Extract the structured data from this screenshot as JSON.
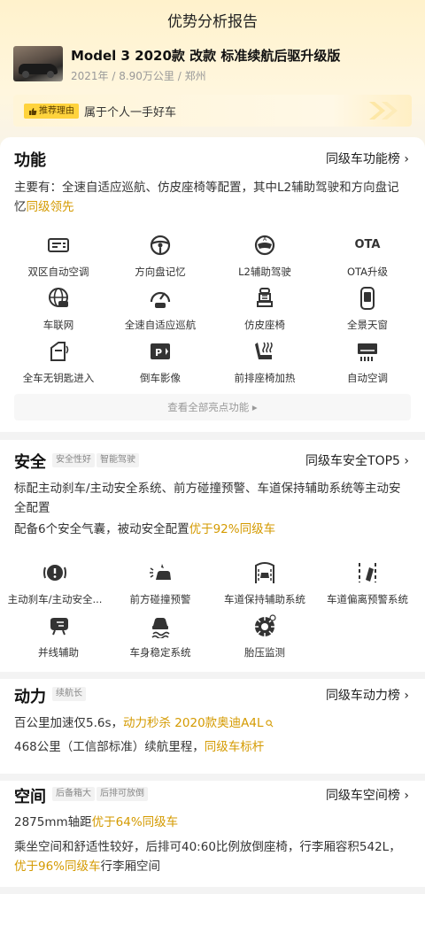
{
  "header": {
    "title": "优势分析报告"
  },
  "car": {
    "name": "Model 3 2020款 改款 标准续航后驱升级版",
    "meta": "2021年 / 8.90万公里 / 郑州",
    "thumb_icon": "car-photo"
  },
  "reason": {
    "tag": "推荐理由",
    "text": "属于个人一手好车"
  },
  "function": {
    "title": "功能",
    "link": "同级车功能榜 ›",
    "desc": "主要有：全速自适应巡航、仿皮座椅等配置，其中L2辅助驾驶和方向盘记忆",
    "desc_highlight": "同级领先",
    "items": [
      {
        "label": "双区自动空调",
        "icon": "dual-zone-ac-icon"
      },
      {
        "label": "方向盘记忆",
        "icon": "steering-wheel-icon"
      },
      {
        "label": "L2辅助驾驶",
        "icon": "assisted-driving-icon"
      },
      {
        "label": "OTA升级",
        "icon": "ota-icon",
        "glyph": "OTA"
      },
      {
        "label": "车联网",
        "icon": "connected-car-icon"
      },
      {
        "label": "全速自适应巡航",
        "icon": "adaptive-cruise-icon"
      },
      {
        "label": "仿皮座椅",
        "icon": "leather-seat-icon"
      },
      {
        "label": "全景天窗",
        "icon": "panoramic-roof-icon"
      },
      {
        "label": "全车无钥匙进入",
        "icon": "keyless-entry-icon"
      },
      {
        "label": "倒车影像",
        "icon": "reverse-camera-icon"
      },
      {
        "label": "前排座椅加热",
        "icon": "seat-heating-icon"
      },
      {
        "label": "自动空调",
        "icon": "auto-ac-icon"
      }
    ],
    "view_all": "查看全部亮点功能 ▸"
  },
  "safety": {
    "title": "安全",
    "chips": [
      "安全性好",
      "智能驾驶"
    ],
    "link": "同级车安全TOP5 ›",
    "desc1": "标配主动刹车/主动安全系统、前方碰撞预警、车道保持辅助系统等主动安全配置",
    "desc2_prefix": "配备6个安全气囊，被动安全配置",
    "desc2_highlight": "优于92%同级车",
    "items": [
      {
        "label": "主动刹车/主动安全...",
        "icon": "active-brake-icon"
      },
      {
        "label": "前方碰撞预警",
        "icon": "collision-warning-icon"
      },
      {
        "label": "车道保持辅助系统",
        "icon": "lane-keep-icon"
      },
      {
        "label": "车道偏离预警系统",
        "icon": "lane-departure-icon"
      },
      {
        "label": "并线辅助",
        "icon": "blind-spot-icon"
      },
      {
        "label": "车身稳定系统",
        "icon": "stability-control-icon"
      },
      {
        "label": "胎压监测",
        "icon": "tire-pressure-icon"
      }
    ]
  },
  "power": {
    "title": "动力",
    "chips": [
      "续航长"
    ],
    "link": "同级车动力榜 ›",
    "line1_prefix": "百公里加速仅5.6s，",
    "line1_highlight": "动力秒杀 2020款奥迪A4L",
    "line2_prefix": "468公里（工信部标准）续航里程，",
    "line2_highlight": "同级车标杆"
  },
  "space": {
    "title": "空间",
    "chips": [
      "后备箱大",
      "后排可放倒"
    ],
    "link": "同级车空间榜 ›",
    "line1_prefix": "2875mm轴距",
    "line1_highlight": "优于64%同级车",
    "line2_prefix": "乘坐空间和舒适性较好，后排可40:60比例放倒座椅，行李厢容积542L，",
    "line2_highlight": "优于96%同级车",
    "line2_suffix": "行李厢空间"
  },
  "colors": {
    "accent": "#d49a00",
    "tag": "#ffd33d",
    "bg_top": "#fff2cc"
  }
}
